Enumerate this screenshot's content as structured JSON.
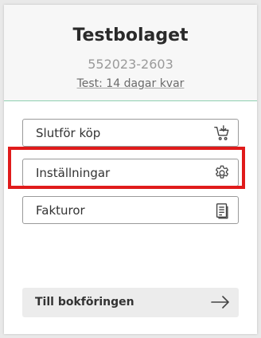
{
  "company": {
    "name": "Testbolaget",
    "org_number": "552023-2603",
    "trial_status": "Test: 14 dagar kvar"
  },
  "menu": {
    "items": [
      {
        "label": "Slutför köp",
        "icon": "cart-icon"
      },
      {
        "label": "Inställningar",
        "icon": "gear-icon",
        "highlighted": true
      },
      {
        "label": "Fakturor",
        "icon": "document-icon"
      }
    ]
  },
  "footer": {
    "primary_label": "Till bokföringen",
    "primary_icon": "arrow-right-icon"
  },
  "colors": {
    "divider": "#8fd0b0",
    "highlight": "#e01b1b"
  }
}
